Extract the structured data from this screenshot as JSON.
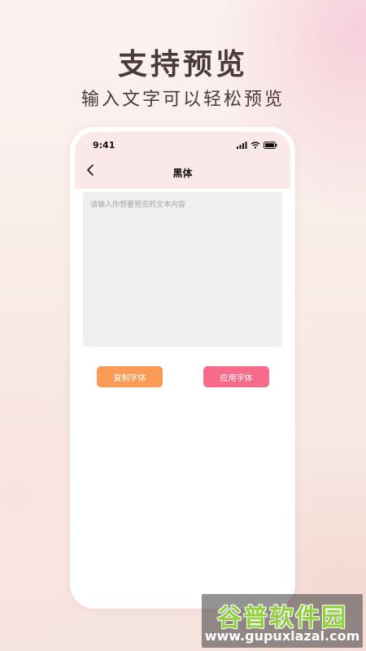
{
  "promo": {
    "headline": "支持预览",
    "subline": "输入文字可以轻松预览"
  },
  "status_bar": {
    "time": "9:41",
    "icons": [
      "signal-icon",
      "wifi-icon",
      "battery-icon"
    ]
  },
  "nav": {
    "back_icon": "chevron-left-icon",
    "title": "黑体"
  },
  "editor": {
    "placeholder": "请输入你想要预览的文本内容",
    "value": ""
  },
  "buttons": {
    "copy_label": "复制字体",
    "apply_label": "应用字体"
  },
  "watermark": {
    "title": "谷普软件园",
    "url": "www.gupuxlazal.com"
  },
  "colors": {
    "copy_button": "#f99b55",
    "apply_button": "#f66b8a",
    "header_bg": "#fbe9e9",
    "text_dark": "#4a3a39"
  }
}
